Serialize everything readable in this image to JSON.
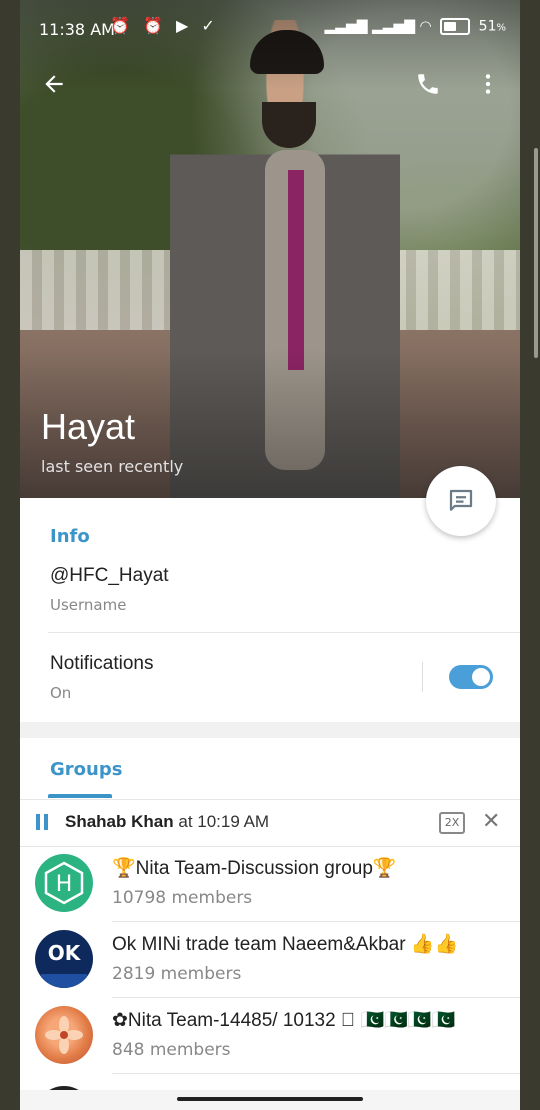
{
  "status_bar": {
    "time": "11:38 AM",
    "left_icons": "⏰ ⏰ ▶ ✓",
    "signal": "▂▃▅▇ ▂▃▅▇",
    "battery": "51",
    "battery_suffix": "%"
  },
  "header": {
    "name": "Hayat",
    "status": "last seen recently"
  },
  "info": {
    "section_title": "Info",
    "username_value": "@HFC_Hayat",
    "username_label": "Username",
    "notifications_label": "Notifications",
    "notifications_state": "On"
  },
  "groups": {
    "section_title": "Groups",
    "items": [
      {
        "name": "🏆Nita Team-Discussion group🏆",
        "members": "10798 members",
        "avatar_color": "#2bb382",
        "avatar_letter": "H"
      },
      {
        "name": "Ok MINi trade team Naeem&Akbar 👍👍",
        "members": "2819 members",
        "avatar_color": "#0e2a5c",
        "avatar_letter": "OK"
      },
      {
        "name": "✿Nita Team-14485/ 10132 ⃣ 🇵🇰🇵🇰🇵🇰🇵🇰",
        "members": "848 members",
        "avatar_color": "#e07a45",
        "avatar_letter": ""
      }
    ]
  },
  "player": {
    "name": "Shahab Khan",
    "time": "at 10:19 AM",
    "speed": "2X"
  },
  "colors": {
    "accent": "#3d94c9",
    "toggle_on": "#4a9fd8"
  }
}
